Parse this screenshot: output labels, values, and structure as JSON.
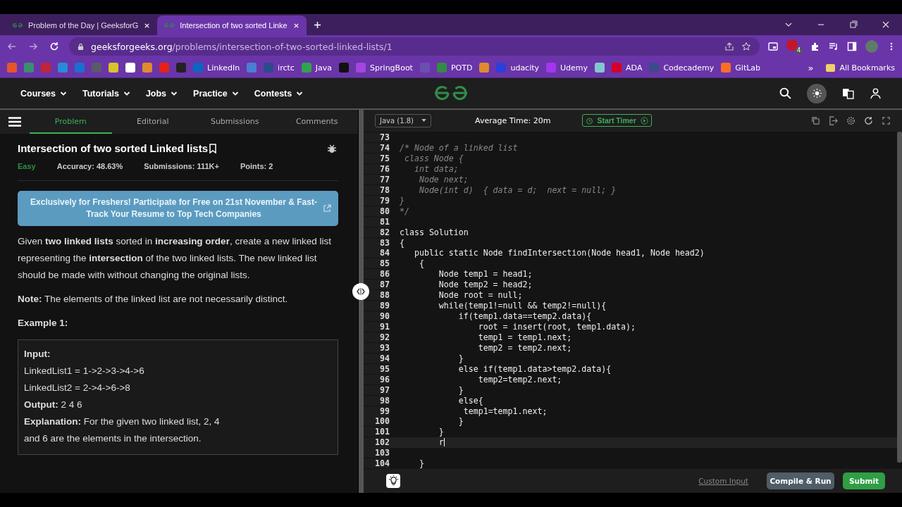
{
  "browser": {
    "tabs": [
      {
        "title": "Problem of the Day | GeeksforG",
        "selected": false
      },
      {
        "title": "Intersection of two sorted Linke",
        "selected": true
      }
    ],
    "url_host": "geeksforgeeks.org",
    "url_path": "/problems/intersection-of-two-sorted-linked-lists/1",
    "extension_badge": "4",
    "bookmarks": [
      {
        "color": "#e8552b"
      },
      {
        "color": "#3b8f6e"
      },
      {
        "color": "#c0243a"
      },
      {
        "color": "#2a8bd8"
      },
      {
        "color": "#1b6fd1"
      },
      {
        "color": "#5a5a6a"
      },
      {
        "color": "#d9c22b"
      },
      {
        "color": "#ffffff"
      },
      {
        "color": "#e28a2e"
      },
      {
        "color": "#e62117"
      },
      {
        "color": "#222222"
      },
      {
        "label": "LinkedIn",
        "color": "#0a66c2"
      },
      {
        "color": "#4a7fd4"
      },
      {
        "label": "irctc",
        "color": "#2c4b8c"
      },
      {
        "label": "Java",
        "color": "#2fa44f"
      },
      {
        "color": "#111111"
      },
      {
        "label": "SpringBoot",
        "color": "#a445e0"
      },
      {
        "color": "#6a4fb0"
      },
      {
        "label": "POTD",
        "color": "#2f8d46"
      },
      {
        "color": "#e08a2e"
      },
      {
        "label": "udacity",
        "color": "#2d3fd9"
      },
      {
        "label": "Udemy",
        "color": "#a435f0"
      },
      {
        "color": "#7fc8d0"
      },
      {
        "label": "ADA",
        "color": "#d6002a"
      },
      {
        "label": "Codecademy",
        "color": "#3d4a8c"
      },
      {
        "label": "GitLab",
        "color": "#fc6d26"
      }
    ],
    "more_bookmarks": "»",
    "all_bookmarks": "All Bookmarks"
  },
  "site": {
    "menus": [
      "Courses",
      "Tutorials",
      "Jobs",
      "Practice",
      "Contests"
    ]
  },
  "problem_tabs": [
    {
      "label": "Problem",
      "selected": true
    },
    {
      "label": "Editorial",
      "selected": false
    },
    {
      "label": "Submissions",
      "selected": false
    },
    {
      "label": "Comments",
      "selected": false
    }
  ],
  "problem": {
    "title": "Intersection of two sorted Linked lists",
    "difficulty": "Easy",
    "accuracy": "Accuracy: 48.63%",
    "submissions": "Submissions: 111K+",
    "points": "Points: 2",
    "banner": "Exclusively for Freshers! Participate for Free on 21st November & Fast-Track Your Resume to Top Tech Companies",
    "paragraphs": [
      "Given **two linked lists** sorted in **increasing order**, create a new linked list representing the **intersection** of the two linked lists. The new linked list should be made with without changing the original lists.",
      "**Note:** The elements of the linked list are not necessarily distinct."
    ],
    "example_title": "Example 1:",
    "example": [
      "**Input:**",
      "LinkedList1 = 1->2->3->4->6",
      "LinkedList2 = 2->4->6->8",
      "**Output:** 2 4 6",
      "**Explanation:** For the given two linked list, 2, 4 and 6 are the elements in the intersection."
    ]
  },
  "editor": {
    "language": "Java (1.8)",
    "average_time": "Average Time: 20m",
    "timer_button": "Start Timer",
    "lines": [
      {
        "num": "73",
        "kind": "code"
      },
      {
        "num": "74",
        "kind": "comment",
        "text": "/* Node of a linked list"
      },
      {
        "num": "75",
        "kind": "comment",
        "text": " class Node {"
      },
      {
        "num": "76",
        "kind": "comment",
        "text": "   int data;"
      },
      {
        "num": "77",
        "kind": "comment",
        "text": "    Node next;"
      },
      {
        "num": "78",
        "kind": "comment",
        "text": "    Node(int d)  { data = d;  next = null; }"
      },
      {
        "num": "79",
        "kind": "comment",
        "text": "}"
      },
      {
        "num": "80",
        "kind": "comment",
        "text": "*/"
      },
      {
        "num": "81",
        "kind": "code"
      },
      {
        "num": "82",
        "kind": "code",
        "text": "class Solution"
      },
      {
        "num": "83",
        "kind": "code",
        "text": "{"
      },
      {
        "num": "84",
        "kind": "code",
        "text": "   public static Node findIntersection(Node head1, Node head2)"
      },
      {
        "num": "85",
        "kind": "code",
        "text": "    {"
      },
      {
        "num": "86",
        "kind": "code",
        "text": "        Node temp1 = head1;"
      },
      {
        "num": "87",
        "kind": "code",
        "text": "        Node temp2 = head2;"
      },
      {
        "num": "88",
        "kind": "code",
        "text": "        Node root = null;"
      },
      {
        "num": "89",
        "kind": "code",
        "text": "        while(temp1!=null && temp2!=null){"
      },
      {
        "num": "90",
        "kind": "code",
        "text": "            if(temp1.data==temp2.data){"
      },
      {
        "num": "91",
        "kind": "code",
        "text": "                root = insert(root, temp1.data);"
      },
      {
        "num": "92",
        "kind": "code",
        "text": "                temp1 = temp1.next;"
      },
      {
        "num": "93",
        "kind": "code",
        "text": "                temp2 = temp2.next;"
      },
      {
        "num": "94",
        "kind": "code",
        "text": "            }"
      },
      {
        "num": "95",
        "kind": "code",
        "text": "            else if(temp1.data>temp2.data){"
      },
      {
        "num": "96",
        "kind": "code",
        "text": "                temp2=temp2.next;"
      },
      {
        "num": "97",
        "kind": "code",
        "text": "            }"
      },
      {
        "num": "98",
        "kind": "code",
        "text": "            else{"
      },
      {
        "num": "99",
        "kind": "code",
        "text": "             temp1=temp1.next;"
      },
      {
        "num": "100",
        "kind": "code",
        "text": "            }"
      },
      {
        "num": "101",
        "kind": "code",
        "text": "        }"
      },
      {
        "num": "102",
        "kind": "current",
        "text": "        r"
      },
      {
        "num": "103",
        "kind": "code"
      },
      {
        "num": "104",
        "kind": "code",
        "text": "    }"
      }
    ],
    "custom_input": "Custom Input",
    "run_button": "Compile & Run",
    "submit_button": "Submit"
  }
}
